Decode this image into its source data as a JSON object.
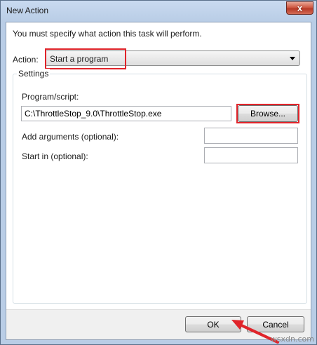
{
  "window": {
    "title": "New Action",
    "close_glyph": "x"
  },
  "dialog": {
    "instruction": "You must specify what action this task will perform.",
    "action_label": "Action:",
    "action_value": "Start a program",
    "settings_legend": "Settings",
    "program_label": "Program/script:",
    "program_value": "C:\\ThrottleStop_9.0\\ThrottleStop.exe",
    "browse_label": "Browse...",
    "args_label": "Add arguments (optional):",
    "args_value": "",
    "startin_label": "Start in (optional):",
    "startin_value": ""
  },
  "footer": {
    "ok_label": "OK",
    "cancel_label": "Cancel"
  },
  "watermark": "wsxdn.com",
  "colors": {
    "highlight": "#e0242a",
    "titlebar": "#c9daf0",
    "client_bg": "#ffffff",
    "footer_bg": "#f0f0f0"
  },
  "icons": {
    "close": "close-icon",
    "dropdown": "chevron-down-icon",
    "pointer": "arrow-pointer-icon"
  }
}
